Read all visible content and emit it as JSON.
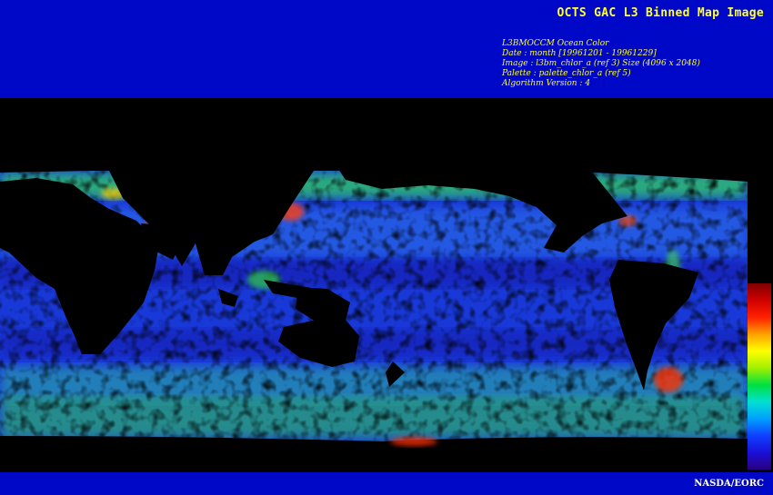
{
  "header": {
    "title": "OCTS GAC L3 Binned Map Image",
    "meta_lines": [
      "L3BMOCCM Ocean Color",
      "Date : month [19961201 - 19961229]",
      "Image : l3bm_chlor_a (ref 3) Size (4096 x 2048)",
      "Palette : palette_chlor_a (ref 5)",
      "Algorithm Version : 4"
    ]
  },
  "footer": {
    "credit": "NASDA/EORC"
  },
  "colors": {
    "band": "#0008c8",
    "title_text": "#ffff33",
    "land": "#000000",
    "ocean_low": "#1030d0",
    "ocean_mid": "#2a70e8",
    "ocean_high": "#30e040"
  },
  "colorbar": {
    "stops": [
      "#2a0080",
      "#1a10d8",
      "#1040ff",
      "#00a0ff",
      "#00e0d0",
      "#00e040",
      "#a0f000",
      "#ffff00",
      "#ffa000",
      "#ff2000",
      "#d00000",
      "#800000"
    ]
  }
}
